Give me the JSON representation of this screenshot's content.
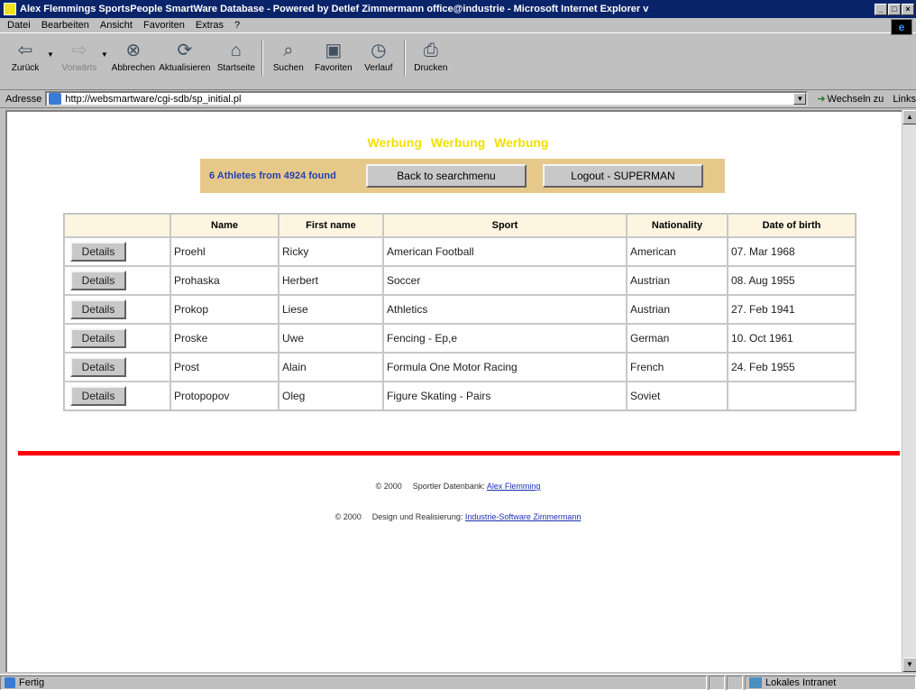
{
  "window": {
    "title": "Alex Flemmings SportsPeople SmartWare Database - Powered by Detlef Zimmermann office@industrie - Microsoft Internet Explorer v",
    "buttons": {
      "minimize": "_",
      "maximize": "□",
      "close": "×"
    }
  },
  "menu": [
    "Datei",
    "Bearbeiten",
    "Ansicht",
    "Favoriten",
    "Extras",
    "?"
  ],
  "toolbar": {
    "back": "Zurück",
    "forward": "Vorwärts",
    "stop": "Abbrechen",
    "refresh": "Aktualisieren",
    "home": "Startseite",
    "search": "Suchen",
    "favorites": "Favoriten",
    "history": "Verlauf",
    "print": "Drucken"
  },
  "address": {
    "label": "Adresse",
    "url": "http://websmartware/cgi-sdb/sp_initial.pl",
    "goto": "Wechseln zu",
    "links": "Links"
  },
  "page": {
    "banner": "Werbung Werbung Werbung",
    "found_text": "6 Athletes from 4924 found",
    "back_button": "Back to searchmenu",
    "logout_button": "Logout - SUPERMAN",
    "table": {
      "headers": [
        "",
        "Name",
        "First name",
        "Sport",
        "Nationality",
        "Date of birth"
      ],
      "details_label": "Details",
      "rows": [
        {
          "name": "Proehl",
          "first": "Ricky",
          "sport": "American Football",
          "nationality": "American",
          "dob": "07. Mar 1968"
        },
        {
          "name": "Prohaska",
          "first": "Herbert",
          "sport": "Soccer",
          "nationality": "Austrian",
          "dob": "08. Aug 1955"
        },
        {
          "name": "Prokop",
          "first": "Liese",
          "sport": "Athletics",
          "nationality": "Austrian",
          "dob": "27. Feb 1941"
        },
        {
          "name": "Proske",
          "first": "Uwe",
          "sport": "Fencing - Ep,e",
          "nationality": "German",
          "dob": "10. Oct 1961"
        },
        {
          "name": "Prost",
          "first": "Alain",
          "sport": "Formula One Motor Racing",
          "nationality": "French",
          "dob": "24. Feb 1955"
        },
        {
          "name": "Protopopov",
          "first": "Oleg",
          "sport": "Figure Skating - Pairs",
          "nationality": "Soviet",
          "dob": ""
        }
      ]
    },
    "footer": {
      "line1_copy": "© 2000",
      "line1_text": "Sportler Datenbank:",
      "line1_link": "Alex Flemming",
      "line2_copy": "© 2000",
      "line2_text": "Design und Realisierung:",
      "line2_link": "Industrie-Software Zimmermann"
    }
  },
  "status": {
    "text": "Fertig",
    "zone": "Lokales Intranet"
  },
  "colors": {
    "banner": "#f2e000",
    "panel": "#e6c98a",
    "found_text": "#2540b0",
    "divider": "#ff0000",
    "titlebar": "#0a246a"
  }
}
